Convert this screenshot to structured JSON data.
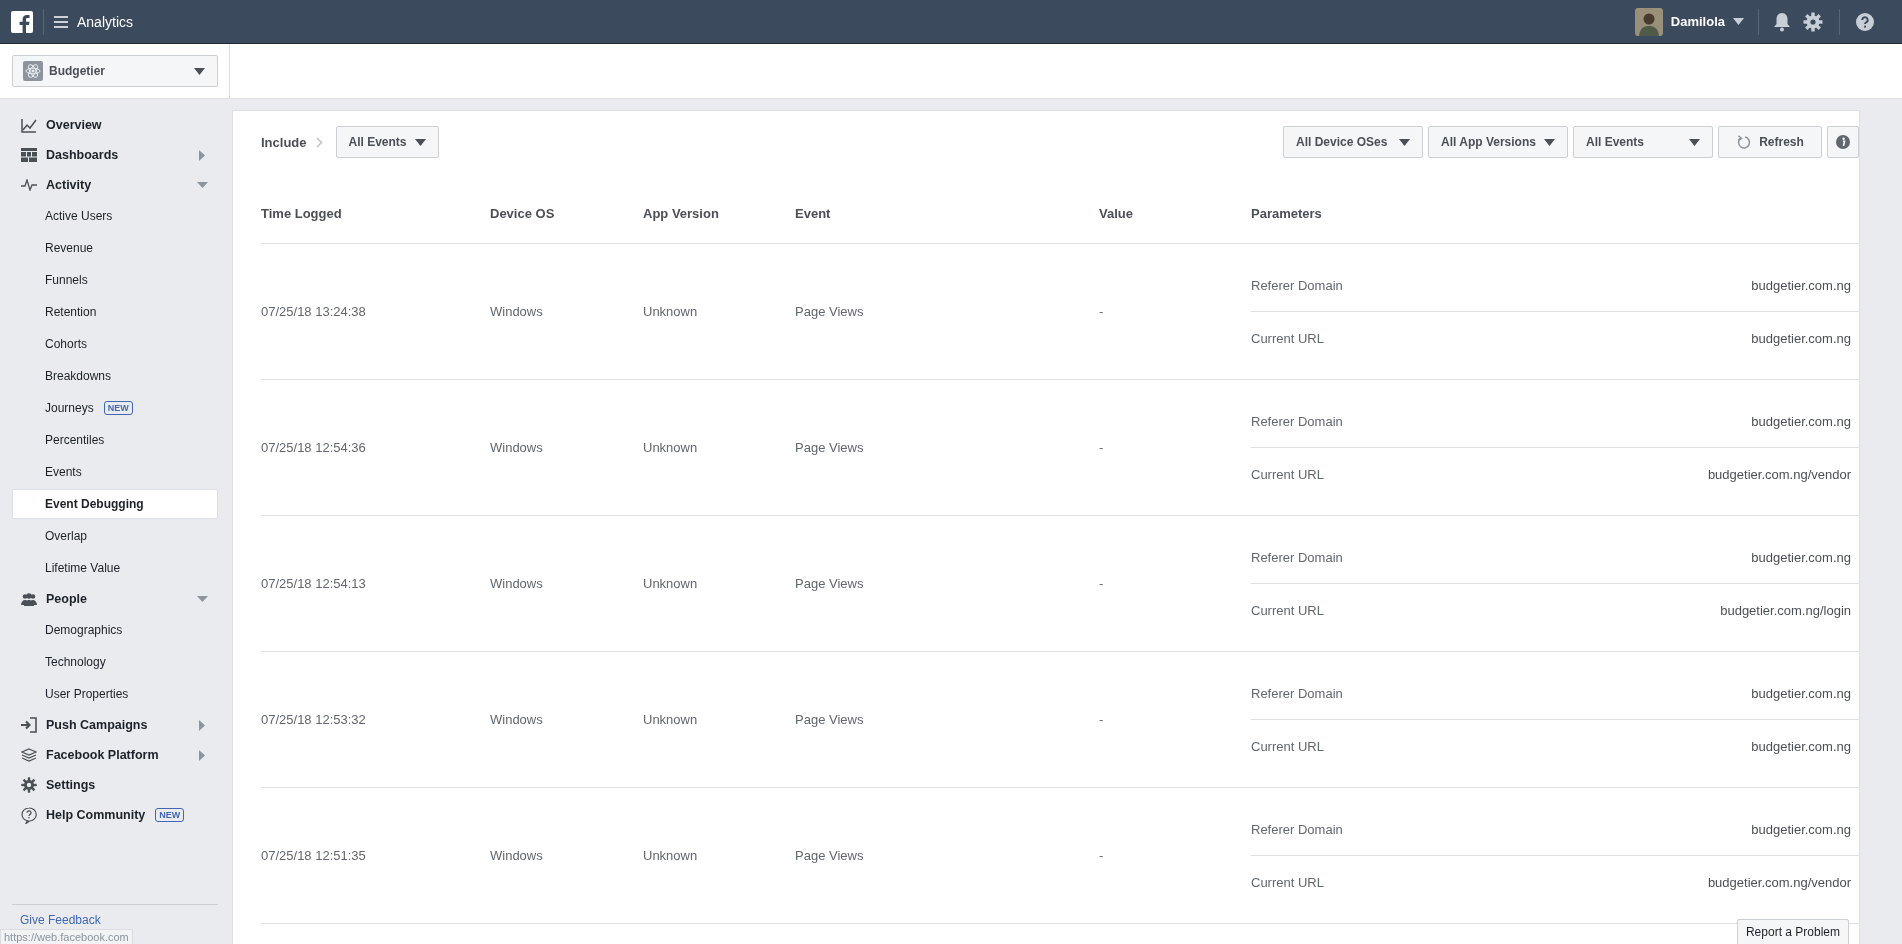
{
  "top_bar": {
    "title": "Analytics",
    "user": "Damilola"
  },
  "app_selector": {
    "value": "Budgetier"
  },
  "sidebar": {
    "items": [
      {
        "label": "Overview"
      },
      {
        "label": "Dashboards",
        "expanded": false
      },
      {
        "label": "Activity",
        "expanded": true,
        "children": [
          {
            "label": "Active Users",
            "selected": false
          },
          {
            "label": "Revenue",
            "selected": false
          },
          {
            "label": "Funnels",
            "selected": false
          },
          {
            "label": "Retention",
            "selected": false
          },
          {
            "label": "Cohorts",
            "selected": false
          },
          {
            "label": "Breakdowns",
            "selected": false
          },
          {
            "label": "Journeys",
            "selected": false,
            "badge": "NEW"
          },
          {
            "label": "Percentiles",
            "selected": false
          },
          {
            "label": "Events",
            "selected": false
          },
          {
            "label": "Event Debugging",
            "selected": true
          },
          {
            "label": "Overlap",
            "selected": false
          },
          {
            "label": "Lifetime Value",
            "selected": false
          }
        ]
      },
      {
        "label": "People",
        "expanded": true,
        "children": [
          {
            "label": "Demographics",
            "selected": false
          },
          {
            "label": "Technology",
            "selected": false
          },
          {
            "label": "User Properties",
            "selected": false
          }
        ]
      },
      {
        "label": "Push Campaigns",
        "expanded": false
      },
      {
        "label": "Facebook Platform",
        "expanded": false
      },
      {
        "label": "Settings"
      },
      {
        "label": "Help Community",
        "badge": "NEW"
      }
    ],
    "give_feedback": "Give Feedback"
  },
  "filters": {
    "include_label": "Include",
    "include_value": "All Events",
    "dropdowns": [
      "All Device OSes",
      "All App Versions",
      "All Events"
    ],
    "refresh": "Refresh"
  },
  "table": {
    "columns": [
      "Time Logged",
      "Device OS",
      "App Version",
      "Event",
      "Value",
      "Parameters"
    ],
    "rows": [
      {
        "time": "07/25/18 13:24:38",
        "os": "Windows",
        "version": "Unknown",
        "event": "Page Views",
        "value": "-",
        "parameters": [
          {
            "name": "Referer Domain",
            "value": "budgetier.com.ng"
          },
          {
            "name": "Current URL",
            "value": "budgetier.com.ng"
          }
        ]
      },
      {
        "time": "07/25/18 12:54:36",
        "os": "Windows",
        "version": "Unknown",
        "event": "Page Views",
        "value": "-",
        "parameters": [
          {
            "name": "Referer Domain",
            "value": "budgetier.com.ng"
          },
          {
            "name": "Current URL",
            "value": "budgetier.com.ng/vendor"
          }
        ]
      },
      {
        "time": "07/25/18 12:54:13",
        "os": "Windows",
        "version": "Unknown",
        "event": "Page Views",
        "value": "-",
        "parameters": [
          {
            "name": "Referer Domain",
            "value": "budgetier.com.ng"
          },
          {
            "name": "Current URL",
            "value": "budgetier.com.ng/login"
          }
        ]
      },
      {
        "time": "07/25/18 12:53:32",
        "os": "Windows",
        "version": "Unknown",
        "event": "Page Views",
        "value": "-",
        "parameters": [
          {
            "name": "Referer Domain",
            "value": "budgetier.com.ng"
          },
          {
            "name": "Current URL",
            "value": "budgetier.com.ng"
          }
        ]
      },
      {
        "time": "07/25/18 12:51:35",
        "os": "Windows",
        "version": "Unknown",
        "event": "Page Views",
        "value": "-",
        "parameters": [
          {
            "name": "Referer Domain",
            "value": "budgetier.com.ng"
          },
          {
            "name": "Current URL",
            "value": "budgetier.com.ng/vendor"
          }
        ]
      }
    ]
  },
  "report_problem": "Report a Problem",
  "status_url": "https://web.facebook.com"
}
